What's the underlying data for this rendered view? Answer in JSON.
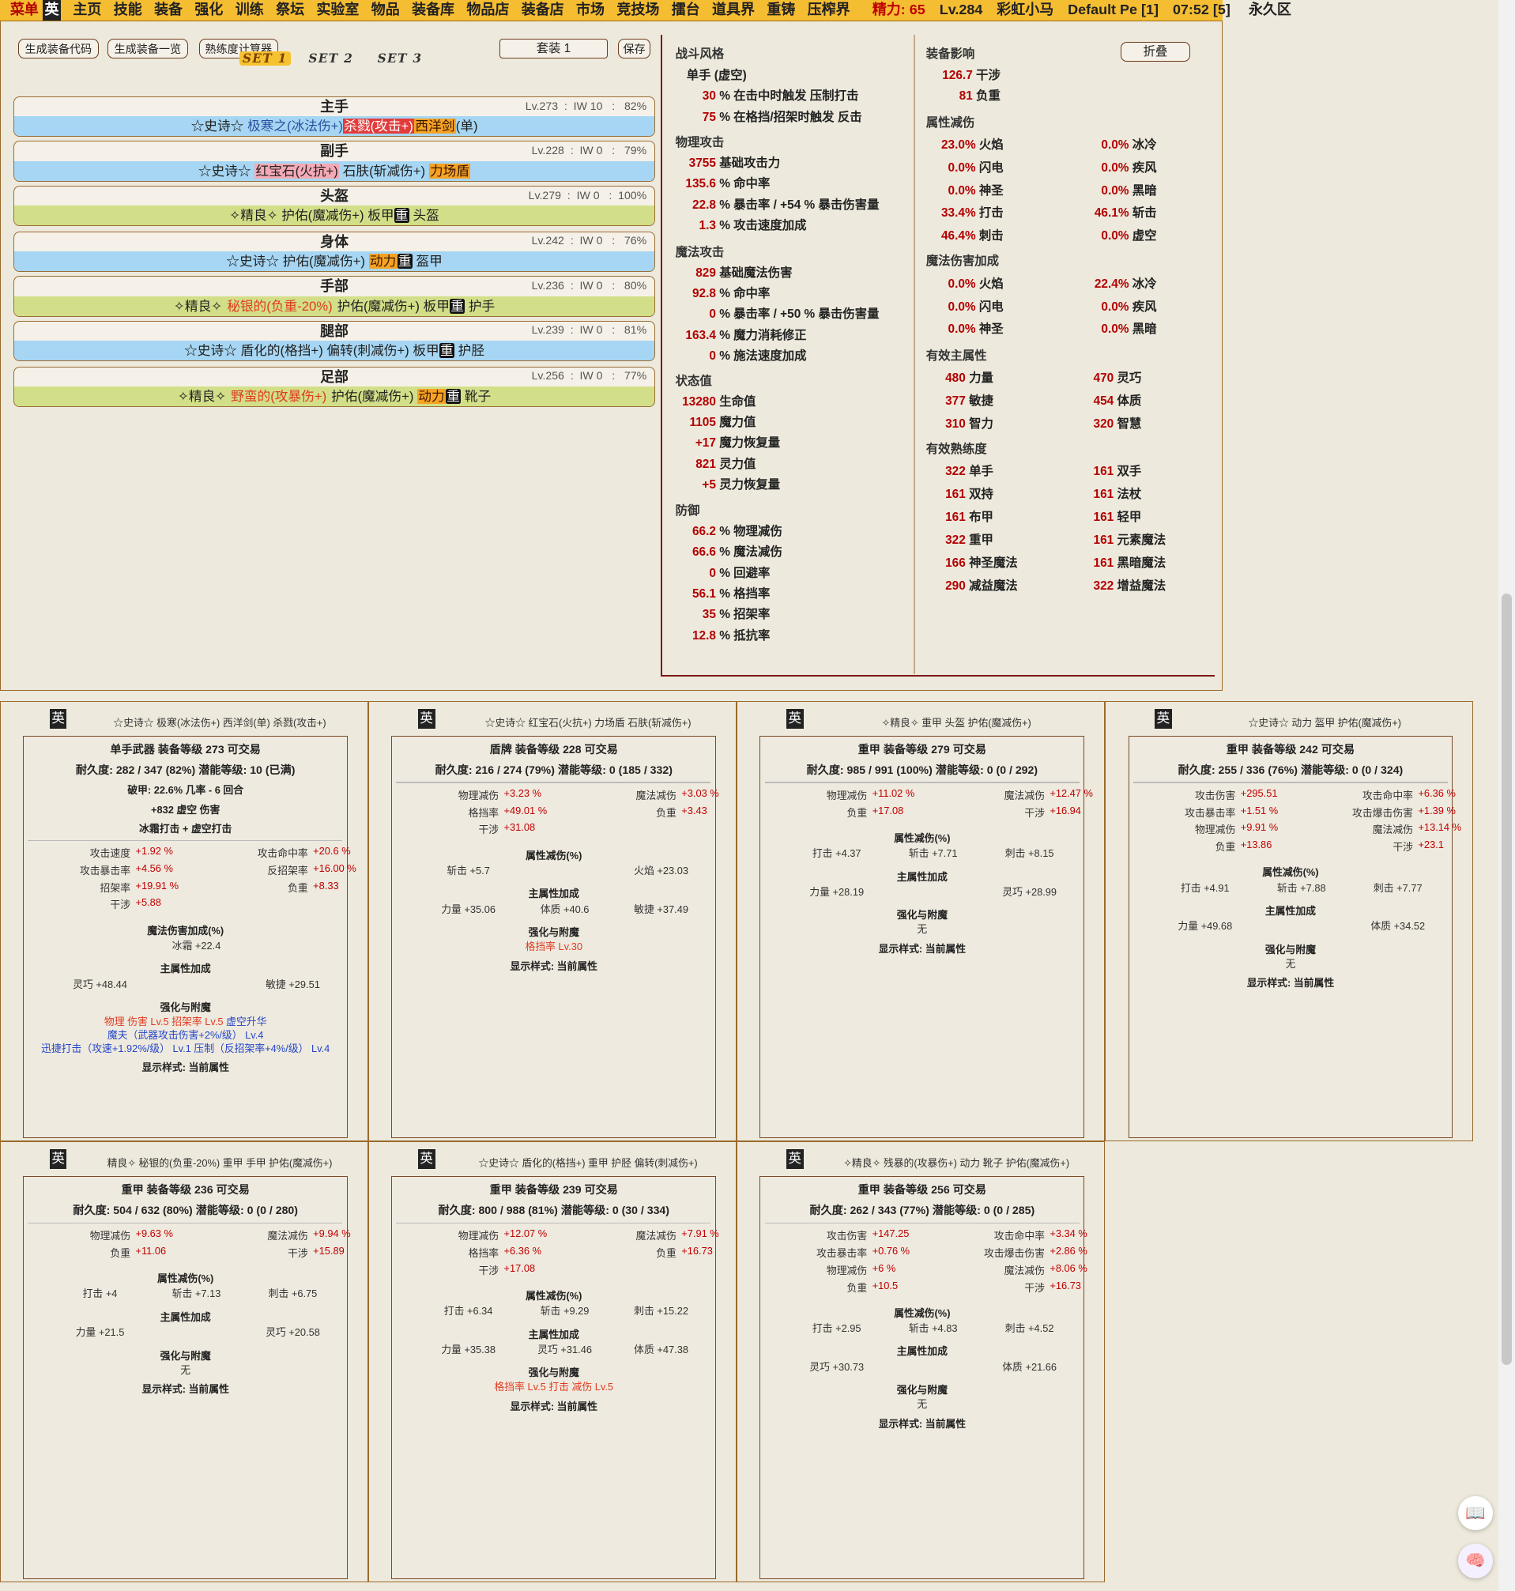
{
  "topbar": {
    "menu": "菜单",
    "eng": "英",
    "nav": [
      "主页",
      "技能",
      "装备",
      "强化",
      "训练",
      "祭坛",
      "实验室",
      "物品",
      "装备库",
      "物品店",
      "装备店",
      "市场",
      "竞技场",
      "擂台",
      "道具界",
      "重铸",
      "压榨界"
    ],
    "energy": "精力: 65",
    "level": "Lv.284",
    "name": "彩虹小马",
    "account": "Default Pe [1]",
    "time": "07:52 [5]",
    "zone": "永久区"
  },
  "buttons": {
    "gen_code": "生成装备代码",
    "gen_list": "生成装备一览",
    "proficiency_calc": "熟练度计算器",
    "set_select": "套装 1",
    "save": "保存",
    "fold": "折叠"
  },
  "set_tabs": [
    "SET 1",
    "SET 2",
    "SET 3"
  ],
  "slots": [
    {
      "title": "主手",
      "meta": "Lv.273  :  IW 10   :   82%"
    },
    {
      "title": "副手",
      "meta": "Lv.228  :  IW 0   :   79%"
    },
    {
      "title": "头盔",
      "meta": "Lv.279  :  IW 0   :  100%"
    },
    {
      "title": "身体",
      "meta": "Lv.242  :  IW 0   :   76%"
    },
    {
      "title": "手部",
      "meta": "Lv.236  :  IW 0   :   80%"
    },
    {
      "title": "腿部",
      "meta": "Lv.239  :  IW 0   :   81%"
    },
    {
      "title": "足部",
      "meta": "Lv.256  :  IW 0   :   77%"
    }
  ],
  "slot_texts": {
    "s1a": "☆史诗☆ ",
    "s1b": "极寒之(冰法伤+)",
    "s1c": "杀戮(攻击+)",
    "s1d": "西洋剑",
    "s1e": "(单)",
    "s2a": "☆史诗☆ ",
    "s2b": "红宝石(火抗+)",
    "s2c": " 石肤(斩减伤+) ",
    "s2d": "力场盾",
    "s3a": "✧精良✧ 护佑(魔减伤+) 板甲",
    "s3b": "重",
    "s3c": " 头盔",
    "s4a": "☆史诗☆ 护佑(魔减伤+) ",
    "s4b": "动力",
    "s4c": "重",
    "s4d": " 盔甲",
    "s5a": "✧精良✧ ",
    "s5b": "秘银的(负重-20%)",
    "s5c": " 护佑(魔减伤+) 板甲",
    "s5d": "重",
    "s5e": " 护手",
    "s6a": "☆史诗☆ 盾化的(格挡+) 偏转(刺减伤+) 板甲",
    "s6b": "重",
    "s6c": " 护胫",
    "s7a": "✧精良✧ ",
    "s7b": "野蛮的(攻暴伤+)",
    "s7c": " 护佑(魔减伤+) ",
    "s7d": "动力",
    "s7e": "重",
    "s7f": " 靴子"
  },
  "left_stats": {
    "h_style": "战斗风格",
    "style_name": "单手 (虚空)",
    "style1": {
      "v": "30",
      "l": "% 在击中时触发 压制打击"
    },
    "style2": {
      "v": "75",
      "l": "% 在格挡/招架时触发 反击"
    },
    "h_phys": "物理攻击",
    "p1": {
      "v": "3755",
      "l": "基础攻击力"
    },
    "p2": {
      "v": "135.6",
      "l": "% 命中率"
    },
    "p3": {
      "v": "22.8",
      "l": "% 暴击率 / +54 % 暴击伤害量"
    },
    "p4": {
      "v": "1.3",
      "l": "% 攻击速度加成"
    },
    "h_mag": "魔法攻击",
    "m1": {
      "v": "829",
      "l": "基础魔法伤害"
    },
    "m2": {
      "v": "92.8",
      "l": "% 命中率"
    },
    "m3": {
      "v": "0",
      "l": "% 暴击率 / +50 % 暴击伤害量"
    },
    "m4": {
      "v": "163.4",
      "l": "% 魔力消耗修正"
    },
    "m5": {
      "v": "0",
      "l": "% 施法速度加成"
    },
    "h_state": "状态值",
    "st1": {
      "v": "13280",
      "l": "生命值"
    },
    "st2": {
      "v": "1105",
      "l": "魔力值"
    },
    "st3": {
      "v": "+17",
      "l": "魔力恢复量"
    },
    "st4": {
      "v": "821",
      "l": "灵力值"
    },
    "st5": {
      "v": "+5",
      "l": "灵力恢复量"
    },
    "h_def": "防御",
    "d1": {
      "v": "66.2",
      "l": "% 物理减伤"
    },
    "d2": {
      "v": "66.6",
      "l": "% 魔法减伤"
    },
    "d3": {
      "v": "0",
      "l": "% 回避率"
    },
    "d4": {
      "v": "56.1",
      "l": "% 格挡率"
    },
    "d5": {
      "v": "35",
      "l": "% 招架率"
    },
    "d6": {
      "v": "12.8",
      "l": "% 抵抗率"
    }
  },
  "right_stats": {
    "h_influence": "装备影响",
    "i1": {
      "v": "126.7",
      "l": "干涉"
    },
    "i2": {
      "v": "81",
      "l": "负重"
    },
    "h_elemres": "属性减伤",
    "er": [
      {
        "v": "23.0%",
        "l": "火焰"
      },
      {
        "v": "0.0%",
        "l": "冰冷"
      },
      {
        "v": "0.0%",
        "l": "闪电"
      },
      {
        "v": "0.0%",
        "l": "疾风"
      },
      {
        "v": "0.0%",
        "l": "神圣"
      },
      {
        "v": "0.0%",
        "l": "黑暗"
      },
      {
        "v": "33.4%",
        "l": "打击"
      },
      {
        "v": "46.1%",
        "l": "斩击"
      },
      {
        "v": "46.4%",
        "l": "刺击"
      },
      {
        "v": "0.0%",
        "l": "虚空"
      }
    ],
    "h_magbonus": "魔法伤害加成",
    "mb": [
      {
        "v": "0.0%",
        "l": "火焰"
      },
      {
        "v": "22.4%",
        "l": "冰冷"
      },
      {
        "v": "0.0%",
        "l": "闪电"
      },
      {
        "v": "0.0%",
        "l": "疾风"
      },
      {
        "v": "0.0%",
        "l": "神圣"
      },
      {
        "v": "0.0%",
        "l": "黑暗"
      }
    ],
    "h_primary": "有效主属性",
    "pa": [
      {
        "v": "480",
        "l": "力量"
      },
      {
        "v": "470",
        "l": "灵巧"
      },
      {
        "v": "377",
        "l": "敏捷"
      },
      {
        "v": "454",
        "l": "体质"
      },
      {
        "v": "310",
        "l": "智力"
      },
      {
        "v": "320",
        "l": "智慧"
      }
    ],
    "h_prof": "有效熟练度",
    "pf": [
      {
        "v": "322",
        "l": "单手"
      },
      {
        "v": "161",
        "l": "双手"
      },
      {
        "v": "161",
        "l": "双持"
      },
      {
        "v": "161",
        "l": "法杖"
      },
      {
        "v": "161",
        "l": "布甲"
      },
      {
        "v": "161",
        "l": "轻甲"
      },
      {
        "v": "322",
        "l": "重甲"
      },
      {
        "v": "161",
        "l": "元素魔法"
      },
      {
        "v": "166",
        "l": "神圣魔法"
      },
      {
        "v": "161",
        "l": "黑暗魔法"
      },
      {
        "v": "290",
        "l": "减益魔法"
      },
      {
        "v": "322",
        "l": "增益魔法"
      }
    ]
  },
  "cards": [
    {
      "title": "☆史诗☆ 极寒(冰法伤+) 西洋剑(单) 杀戮(攻击+)",
      "type": "单手武器    装备等级 273     可交易",
      "dur": "耐久度: 282 / 347 (82%)     潜能等级: 10 (已满)",
      "lines": [
        {
          "x": 0,
          "t": "破甲: 22.6% 几率 - 6 回合",
          "c": 1,
          "b": 1
        },
        {
          "x": 0,
          "t": "+832 虚空 伤害",
          "c": 1,
          "b": 1
        },
        {
          "x": 0,
          "t": "冰霜打击 + 虚空打击",
          "c": 1,
          "b": 1
        }
      ],
      "stats": [
        [
          "攻击速度",
          "+1.92 %"
        ],
        [
          "攻击命中率",
          "+20.6 %"
        ],
        [
          "攻击暴击率",
          "+4.56 %"
        ],
        [
          "反招架率",
          "+16.00 %"
        ],
        [
          "招架率",
          "+19.91 %"
        ],
        [
          "负重",
          "+8.33"
        ],
        [
          "干涉",
          "+5.88"
        ]
      ],
      "sec": [
        {
          "h": "魔法伤害加成(%)",
          "items": [
            [
              "冰霜",
              "+22.4",
              2
            ]
          ]
        },
        {
          "h": "主属性加成",
          "items": [
            [
              "灵巧",
              "+48.44",
              1
            ],
            [
              "敏捷",
              "+29.51",
              3
            ]
          ]
        }
      ],
      "ench_h": "强化与附魔",
      "ench": [
        {
          "t": "物理 伤害 Lv.5   招架率 Lv.5   ",
          "c": "rl",
          "u": "虚空升华"
        },
        {
          "t": "魔夫（武器攻击伤害+2%/级）  Lv.4",
          "c": "bl"
        },
        {
          "t": "迅捷打击（攻速+1.92%/级）  Lv.1   压制（反招架率+4%/级）   Lv.4",
          "c": "bl"
        }
      ],
      "foot": "显示样式: 当前属性"
    },
    {
      "title": "☆史诗☆ 红宝石(火抗+) 力场盾 石肤(斩减伤+)",
      "type": "盾牌    装备等级 228     可交易",
      "dur": "耐久度: 216 / 274 (79%)     潜能等级: 0 (185 / 332)",
      "stats": [
        [
          "物理减伤",
          "+3.23 %"
        ],
        [
          "魔法减伤",
          "+3.03 %"
        ],
        [
          "格挡率",
          "+49.01 %"
        ],
        [
          "负重",
          "+3.43"
        ],
        [
          "干涉",
          "+31.08"
        ]
      ],
      "sec": [
        {
          "h": "属性减伤(%)",
          "items": [
            [
              "斩击",
              "+5.7",
              1
            ],
            [
              "火焰",
              "+23.03",
              3
            ]
          ]
        },
        {
          "h": "主属性加成",
          "items": [
            [
              "力量",
              "+35.06",
              1
            ],
            [
              "体质",
              "+40.6",
              2
            ],
            [
              "敏捷",
              "+37.49",
              3
            ]
          ]
        }
      ],
      "ench_h": "强化与附魔",
      "ench": [
        {
          "t": "格挡率 Lv.30",
          "c": "rl"
        }
      ],
      "foot": "显示样式: 当前属性"
    },
    {
      "title": "✧精良✧ 重甲 头盔 护佑(魔减伤+)",
      "type": "重甲    装备等级 279     可交易",
      "dur": "耐久度: 985 / 991 (100%)     潜能等级: 0 (0 / 292)",
      "stats": [
        [
          "物理减伤",
          "+11.02 %"
        ],
        [
          "魔法减伤",
          "+12.47 %"
        ],
        [
          "负重",
          "+17.08"
        ],
        [
          "干涉",
          "+16.94"
        ]
      ],
      "sec": [
        {
          "h": "属性减伤(%)",
          "items": [
            [
              "打击",
              "+4.37",
              1
            ],
            [
              "斩击",
              "+7.71",
              2
            ],
            [
              "刺击",
              "+8.15",
              3
            ]
          ]
        },
        {
          "h": "主属性加成",
          "items": [
            [
              "力量",
              "+28.19",
              1
            ],
            [
              "灵巧",
              "+28.99",
              3
            ]
          ]
        }
      ],
      "ench_h": "强化与附魔",
      "ench": [
        {
          "t": "无",
          "c": ""
        }
      ],
      "foot": "显示样式: 当前属性"
    },
    {
      "title": "☆史诗☆ 动力 盔甲 护佑(魔减伤+)",
      "type": "重甲    装备等级 242     可交易",
      "dur": "耐久度: 255 / 336 (76%)     潜能等级: 0 (0 / 324)",
      "stats": [
        [
          "攻击伤害",
          "+295.51"
        ],
        [
          "攻击命中率",
          "+6.36 %"
        ],
        [
          "攻击暴击率",
          "+1.51 %"
        ],
        [
          "攻击爆击伤害",
          "+1.39 %"
        ],
        [
          "物理减伤",
          "+9.91 %"
        ],
        [
          "魔法减伤",
          "+13.14 %"
        ],
        [
          "负重",
          "+13.86"
        ],
        [
          "干涉",
          "+23.1"
        ]
      ],
      "sec": [
        {
          "h": "属性减伤(%)",
          "items": [
            [
              "打击",
              "+4.91",
              1
            ],
            [
              "斩击",
              "+7.88",
              2
            ],
            [
              "刺击",
              "+7.77",
              3
            ]
          ]
        },
        {
          "h": "主属性加成",
          "items": [
            [
              "力量",
              "+49.68",
              1
            ],
            [
              "体质",
              "+34.52",
              3
            ]
          ]
        }
      ],
      "ench_h": "强化与附魔",
      "ench": [
        {
          "t": "无",
          "c": ""
        }
      ],
      "foot": "显示样式: 当前属性"
    },
    {
      "title": "精良✧ 秘银的(负重-20%) 重甲 手甲 护佑(魔减伤+)",
      "type": "重甲    装备等级 236     可交易",
      "dur": "耐久度: 504 / 632 (80%)     潜能等级: 0 (0 / 280)",
      "stats": [
        [
          "物理减伤",
          "+9.63 %"
        ],
        [
          "魔法减伤",
          "+9.94 %"
        ],
        [
          "负重",
          "+11.06"
        ],
        [
          "干涉",
          "+15.89"
        ]
      ],
      "sec": [
        {
          "h": "属性减伤(%)",
          "items": [
            [
              "打击",
              "+4",
              1
            ],
            [
              "斩击",
              "+7.13",
              2
            ],
            [
              "刺击",
              "+6.75",
              3
            ]
          ]
        },
        {
          "h": "主属性加成",
          "items": [
            [
              "力量",
              "+21.5",
              1
            ],
            [
              "灵巧",
              "+20.58",
              3
            ]
          ]
        }
      ],
      "ench_h": "强化与附魔",
      "ench": [
        {
          "t": "无",
          "c": ""
        }
      ],
      "foot": "显示样式: 当前属性"
    },
    {
      "title": "☆史诗☆ 盾化的(格挡+) 重甲 护胫 偏转(刺减伤+)",
      "type": "重甲    装备等级 239     可交易",
      "dur": "耐久度: 800 / 988 (81%)     潜能等级: 0 (30 / 334)",
      "stats": [
        [
          "物理减伤",
          "+12.07 %"
        ],
        [
          "魔法减伤",
          "+7.91 %"
        ],
        [
          "格挡率",
          "+6.36 %"
        ],
        [
          "负重",
          "+16.73"
        ],
        [
          "干涉",
          "+17.08"
        ]
      ],
      "sec": [
        {
          "h": "属性减伤(%)",
          "items": [
            [
              "打击",
              "+6.34",
              1
            ],
            [
              "斩击",
              "+9.29",
              2
            ],
            [
              "刺击",
              "+15.22",
              3
            ]
          ]
        },
        {
          "h": "主属性加成",
          "items": [
            [
              "力量",
              "+35.38",
              1
            ],
            [
              "灵巧",
              "+31.46",
              2
            ],
            [
              "体质",
              "+47.38",
              3
            ]
          ]
        }
      ],
      "ench_h": "强化与附魔",
      "ench": [
        {
          "t": "格挡率 Lv.5   打击 减伤 Lv.5",
          "c": "rl"
        }
      ],
      "foot": "显示样式: 当前属性"
    },
    {
      "title": "✧精良✧ 残暴的(攻暴伤+) 动力 靴子 护佑(魔减伤+)",
      "type": "重甲    装备等级 256     可交易",
      "dur": "耐久度: 262 / 343 (77%)     潜能等级: 0 (0 / 285)",
      "stats": [
        [
          "攻击伤害",
          "+147.25"
        ],
        [
          "攻击命中率",
          "+3.34 %"
        ],
        [
          "攻击暴击率",
          "+0.76 %"
        ],
        [
          "攻击爆击伤害",
          "+2.86 %"
        ],
        [
          "物理减伤",
          "+6 %"
        ],
        [
          "魔法减伤",
          "+8.06 %"
        ],
        [
          "负重",
          "+10.5"
        ],
        [
          "干涉",
          "+16.73"
        ]
      ],
      "sec": [
        {
          "h": "属性减伤(%)",
          "items": [
            [
              "打击",
              "+2.95",
              1
            ],
            [
              "斩击",
              "+4.83",
              2
            ],
            [
              "刺击",
              "+4.52",
              3
            ]
          ]
        },
        {
          "h": "主属性加成",
          "items": [
            [
              "灵巧",
              "+30.73",
              1
            ],
            [
              "体质",
              "+21.66",
              3
            ]
          ]
        }
      ],
      "ench_h": "强化与附魔",
      "ench": [
        {
          "t": "无",
          "c": ""
        }
      ],
      "foot": "显示样式: 当前属性"
    }
  ],
  "card_icon": "英",
  "float_icons": [
    "book-icon",
    "brain-icon"
  ]
}
